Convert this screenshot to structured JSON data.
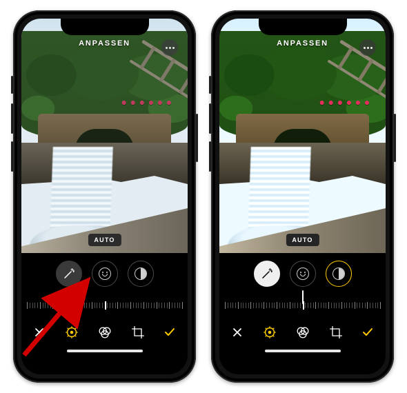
{
  "left": {
    "title": "ANPASSEN",
    "auto_label": "AUTO",
    "adjustments": {
      "wand_selected": true,
      "wand_style": "active",
      "contrast_accent": false
    }
  },
  "right": {
    "title": "ANPASSEN",
    "auto_label": "AUTO",
    "adjustments": {
      "wand_selected": true,
      "wand_style": "inverse",
      "contrast_accent": true
    }
  },
  "toolbar": {
    "cancel_icon": "×",
    "confirm_icon": "✓"
  }
}
